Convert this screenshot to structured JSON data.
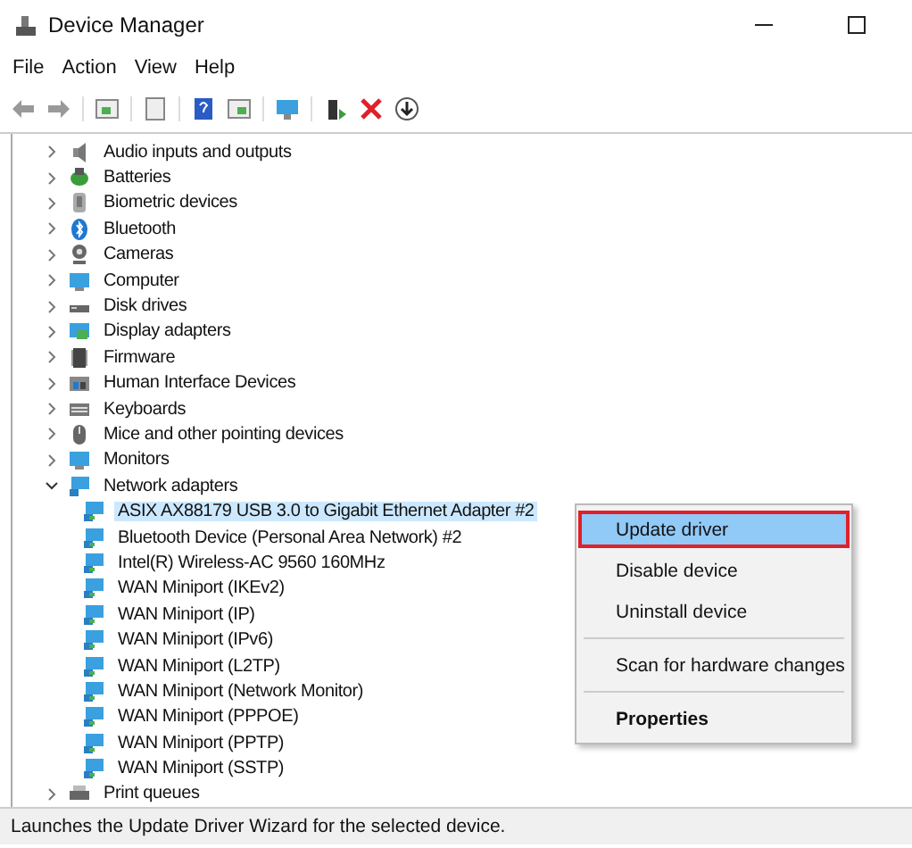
{
  "window": {
    "title": "Device Manager"
  },
  "menu_bar": [
    "File",
    "Action",
    "View",
    "Help"
  ],
  "tree": [
    {
      "label": "Audio inputs and outputs",
      "expanded": false
    },
    {
      "label": "Batteries",
      "expanded": false
    },
    {
      "label": "Biometric devices",
      "expanded": false
    },
    {
      "label": "Bluetooth",
      "expanded": false
    },
    {
      "label": "Cameras",
      "expanded": false
    },
    {
      "label": "Computer",
      "expanded": false
    },
    {
      "label": "Disk drives",
      "expanded": false
    },
    {
      "label": "Display adapters",
      "expanded": false
    },
    {
      "label": "Firmware",
      "expanded": false
    },
    {
      "label": "Human Interface Devices",
      "expanded": false
    },
    {
      "label": "Keyboards",
      "expanded": false
    },
    {
      "label": "Mice and other pointing devices",
      "expanded": false
    },
    {
      "label": "Monitors",
      "expanded": false
    },
    {
      "label": "Network adapters",
      "expanded": true,
      "children": [
        {
          "label": "ASIX AX88179 USB 3.0 to Gigabit Ethernet Adapter #2",
          "selected": true
        },
        {
          "label": "Bluetooth Device (Personal Area Network) #2",
          "selected": false
        },
        {
          "label": "Intel(R) Wireless-AC 9560 160MHz",
          "selected": false
        },
        {
          "label": "WAN Miniport (IKEv2)",
          "selected": false
        },
        {
          "label": "WAN Miniport (IP)",
          "selected": false
        },
        {
          "label": "WAN Miniport (IPv6)",
          "selected": false
        },
        {
          "label": "WAN Miniport (L2TP)",
          "selected": false
        },
        {
          "label": "WAN Miniport (Network Monitor)",
          "selected": false
        },
        {
          "label": "WAN Miniport (PPPOE)",
          "selected": false
        },
        {
          "label": "WAN Miniport (PPTP)",
          "selected": false
        },
        {
          "label": "WAN Miniport (SSTP)",
          "selected": false
        }
      ]
    },
    {
      "label": "Print queues",
      "expanded": false
    }
  ],
  "context_menu": {
    "groups": [
      [
        {
          "label": "Update driver",
          "selected": true,
          "kind": "action"
        },
        {
          "label": "Disable device",
          "selected": false,
          "kind": "action"
        },
        {
          "label": "Uninstall device",
          "selected": false,
          "kind": "action"
        }
      ],
      [
        {
          "label": "Scan for hardware changes",
          "selected": false,
          "kind": "action"
        }
      ],
      [
        {
          "label": "Properties",
          "selected": false,
          "kind": "default"
        }
      ]
    ]
  },
  "status_bar": "Launches the Update Driver Wizard for the selected device."
}
